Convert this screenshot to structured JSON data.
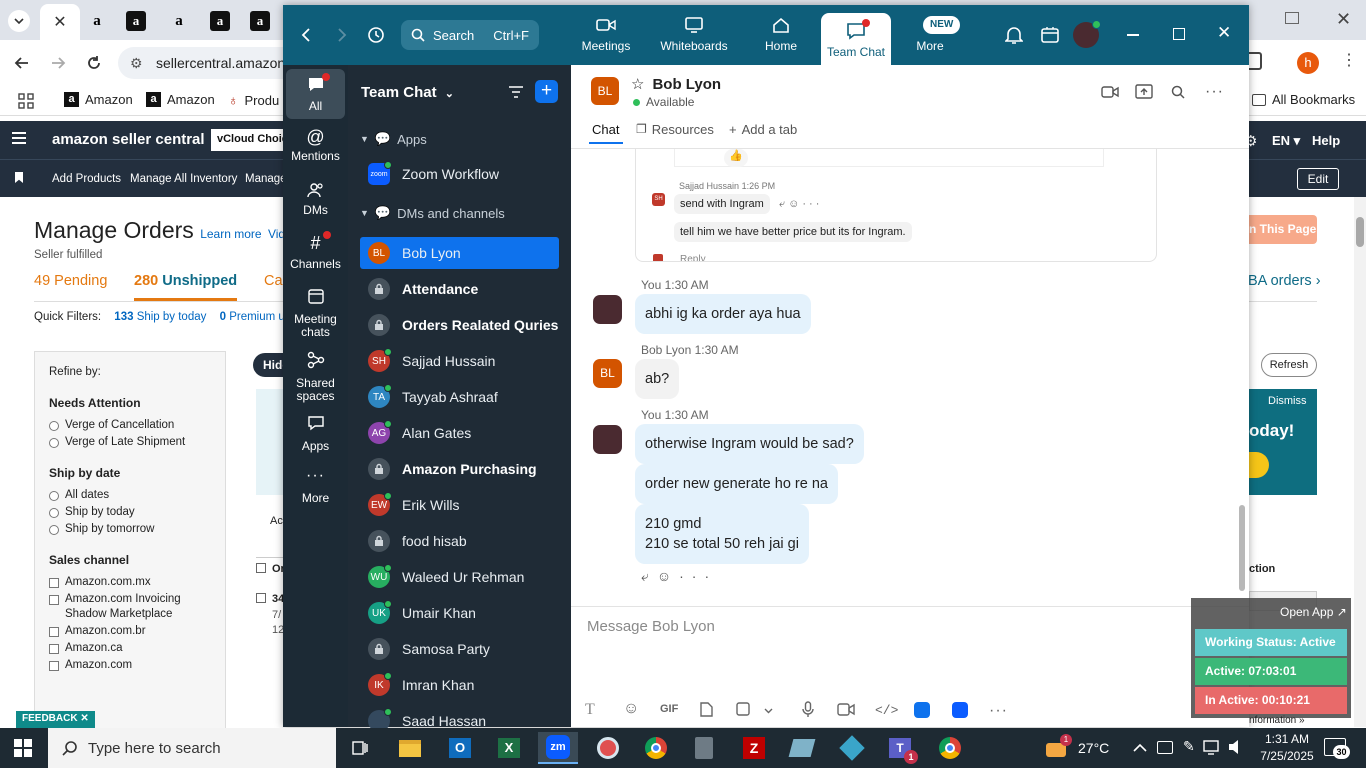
{
  "browser": {
    "url": "sellercentral.amazon",
    "bookmarks": [
      "Amazon",
      "Amazon",
      "Produ"
    ],
    "all_bookmarks": "All Bookmarks",
    "tab_letters": [
      "a",
      "a",
      "a",
      "a",
      "a"
    ],
    "profile_initial": "h"
  },
  "amazon": {
    "brand": "amazon seller central",
    "store": "vCloud Choic",
    "lang": "EN",
    "help": "Help",
    "nav": [
      "Add Products",
      "Manage All Inventory",
      "Manage"
    ],
    "edit": "Edit",
    "page_title": "Manage Orders",
    "learn_more": "Learn more",
    "video": "Vide",
    "seller_fulfilled": "Seller fulfilled",
    "tabs": [
      {
        "count": "49",
        "label": "Pending"
      },
      {
        "count": "280",
        "label": "Unshipped"
      },
      {
        "count": "",
        "label": "Car"
      }
    ],
    "fba_orders": "BA orders",
    "quick_filters_label": "Quick Filters:",
    "quick_filters": [
      {
        "count": "133",
        "label": "Ship by today"
      },
      {
        "count": "0",
        "label": "Premium u"
      }
    ],
    "refine_by": "Refine by:",
    "needs_attention": "Needs Attention",
    "attention_opts": [
      "Verge of Cancellation",
      "Verge of Late Shipment"
    ],
    "ship_by_date": "Ship by date",
    "ship_opts": [
      "All dates",
      "Ship by today",
      "Ship by tomorrow"
    ],
    "sales_channel": "Sales channel",
    "channel_opts": [
      "Amazon.com.mx",
      "Amazon.com Invoicing Shadow Marketplace",
      "Amazon.com.br",
      "Amazon.ca",
      "Amazon.com"
    ],
    "hide": "Hide",
    "act": "Ac",
    "col_or": "Or",
    "row_num": "34",
    "row_sub1": "7/",
    "row_sub2": "12",
    "this_page": "n This Page",
    "refresh": "Refresh",
    "dismiss": "Dismiss",
    "promo": "oday!",
    "action_col": "ction",
    "information": "nformation",
    "feedback": "FEEDBACK"
  },
  "zoom": {
    "search": "Search",
    "search_shortcut": "Ctrl+F",
    "nav": [
      {
        "label": "Meetings",
        "icon": "video-camera-icon"
      },
      {
        "label": "Whiteboards",
        "icon": "whiteboard-icon"
      },
      {
        "label": "Home",
        "icon": "home-icon"
      },
      {
        "label": "Team Chat",
        "icon": "chat-icon"
      },
      {
        "label": "More",
        "icon": "more-icon"
      }
    ],
    "new_badge": "NEW",
    "rail": [
      {
        "label": "All",
        "icon": "chat-bubble-icon"
      },
      {
        "label": "Mentions",
        "icon": "at-icon"
      },
      {
        "label": "DMs",
        "icon": "people-icon"
      },
      {
        "label": "Channels",
        "icon": "hash-icon"
      },
      {
        "label": "Meeting chats",
        "icon": "calendar-icon"
      },
      {
        "label": "Shared spaces",
        "icon": "share-icon"
      },
      {
        "label": "Apps",
        "icon": "apps-icon"
      },
      {
        "label": "More",
        "icon": "ellipsis-icon"
      }
    ],
    "sidebar": {
      "title": "Team Chat",
      "apps_section": "Apps",
      "zoom_workflow": "Zoom Workflow",
      "zoom_logo": "zoom",
      "dms_section": "DMs and channels",
      "items": [
        {
          "initials": "BL",
          "name": "Bob Lyon",
          "color": "#d35400",
          "bold": false,
          "lock": false,
          "online": false,
          "selected": true
        },
        {
          "initials": "",
          "name": "Attendance",
          "color": "",
          "bold": true,
          "lock": true,
          "online": false,
          "selected": false
        },
        {
          "initials": "",
          "name": "Orders Realated Quries",
          "color": "",
          "bold": true,
          "lock": true,
          "online": false,
          "selected": false
        },
        {
          "initials": "SH",
          "name": "Sajjad Hussain",
          "color": "#c0392b",
          "bold": false,
          "lock": false,
          "online": true,
          "selected": false
        },
        {
          "initials": "TA",
          "name": "Tayyab Ashraaf",
          "color": "#2e86c1",
          "bold": false,
          "lock": false,
          "online": true,
          "selected": false
        },
        {
          "initials": "AG",
          "name": "Alan Gates",
          "color": "#8e44ad",
          "bold": false,
          "lock": false,
          "online": true,
          "selected": false
        },
        {
          "initials": "",
          "name": "Amazon Purchasing",
          "color": "",
          "bold": true,
          "lock": true,
          "online": false,
          "selected": false
        },
        {
          "initials": "EW",
          "name": "Erik Wills",
          "color": "#c0392b",
          "bold": false,
          "lock": false,
          "online": true,
          "selected": false
        },
        {
          "initials": "",
          "name": "food hisab",
          "color": "",
          "bold": false,
          "lock": true,
          "online": false,
          "selected": false
        },
        {
          "initials": "WU",
          "name": "Waleed Ur Rehman",
          "color": "#27ae60",
          "bold": false,
          "lock": false,
          "online": true,
          "selected": false
        },
        {
          "initials": "UK",
          "name": "Umair Khan",
          "color": "#16a085",
          "bold": false,
          "lock": false,
          "online": true,
          "selected": false
        },
        {
          "initials": "",
          "name": "Samosa Party",
          "color": "",
          "bold": false,
          "lock": true,
          "online": false,
          "selected": false
        },
        {
          "initials": "IK",
          "name": "Imran Khan",
          "color": "#c0392b",
          "bold": false,
          "lock": false,
          "online": true,
          "selected": false
        },
        {
          "initials": "",
          "name": "Saad Hassan",
          "color": "#34495e",
          "bold": false,
          "lock": false,
          "online": true,
          "selected": false
        }
      ]
    },
    "chat": {
      "contact_initials": "BL",
      "contact_name": "Bob Lyon",
      "status": "Available",
      "tabs": [
        "Chat",
        "Resources",
        "Add a tab"
      ],
      "quoted": {
        "sender": "Sajjad Hussain",
        "time": "1:26 PM",
        "initials": "SH",
        "msg1": "send with Ingram",
        "msg2": "tell him we have better price but its for Ingram.",
        "reply": "Reply"
      },
      "messages": [
        {
          "sender": "You",
          "time": "1:30 AM",
          "bubbles": [
            "abhi ig ka order aya hua"
          ],
          "mine": true
        },
        {
          "sender": "Bob Lyon",
          "time": "1:30 AM",
          "bubbles": [
            "ab?"
          ],
          "mine": false
        },
        {
          "sender": "You",
          "time": "1:30 AM",
          "bubbles": [
            "otherwise Ingram would be sad?",
            "order new generate ho re na",
            "210 gmd\n210 se total 50 reh jai gi"
          ],
          "mine": true
        }
      ],
      "composer_placeholder": "Message Bob Lyon",
      "gif": "GIF"
    }
  },
  "tracker": {
    "open_app": "Open App",
    "working_status": "Working Status: Active",
    "active": "Active: 07:03:01",
    "inactive": "In Active: 00:10:21"
  },
  "taskbar": {
    "search_placeholder": "Type here to search",
    "weather": "27°C",
    "weather_badge": "1",
    "time": "1:31 AM",
    "date": "7/25/2025",
    "notifications": "30",
    "teams_badge": "1"
  }
}
